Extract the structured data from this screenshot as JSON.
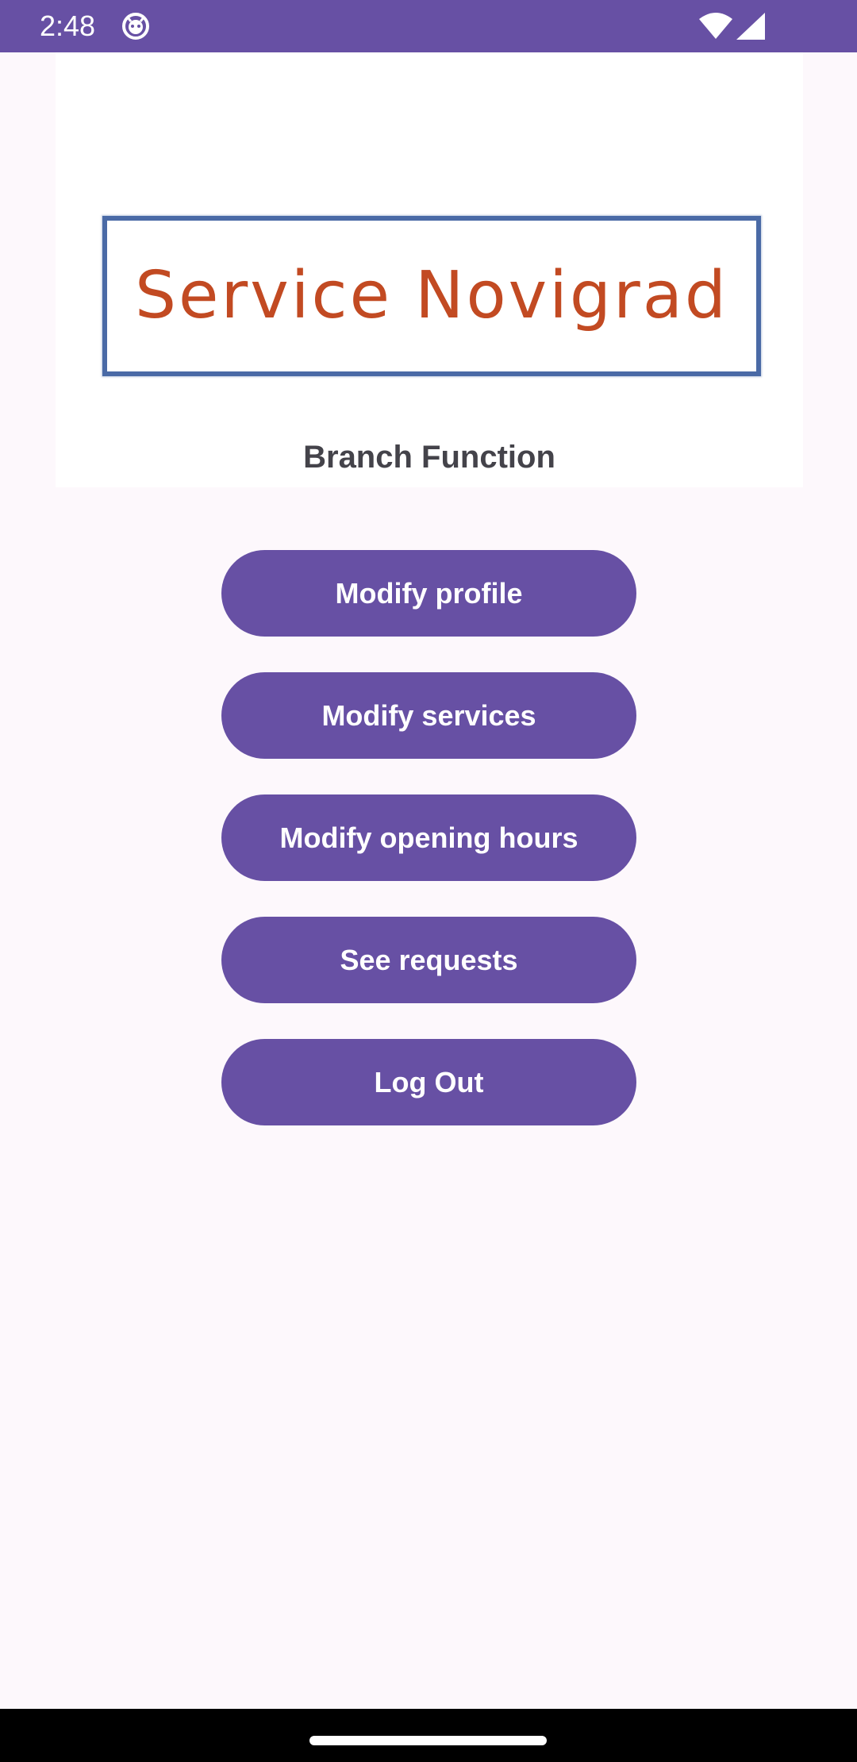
{
  "status_bar": {
    "time": "2:48",
    "icons": [
      "android-face-icon",
      "wifi-icon",
      "cellular-signal-icon"
    ]
  },
  "header": {
    "logo_text": "Service Novigrad",
    "title": "Branch Function"
  },
  "menu": {
    "buttons": [
      {
        "label": "Modify profile"
      },
      {
        "label": "Modify services"
      },
      {
        "label": "Modify opening hours"
      },
      {
        "label": "See requests"
      },
      {
        "label": "Log Out"
      }
    ]
  },
  "colors": {
    "primary": "#6750a4",
    "background": "#fdf8fc",
    "logo_text": "#c24a22",
    "logo_border": "#4a6aa6",
    "title_text": "#44434a"
  }
}
